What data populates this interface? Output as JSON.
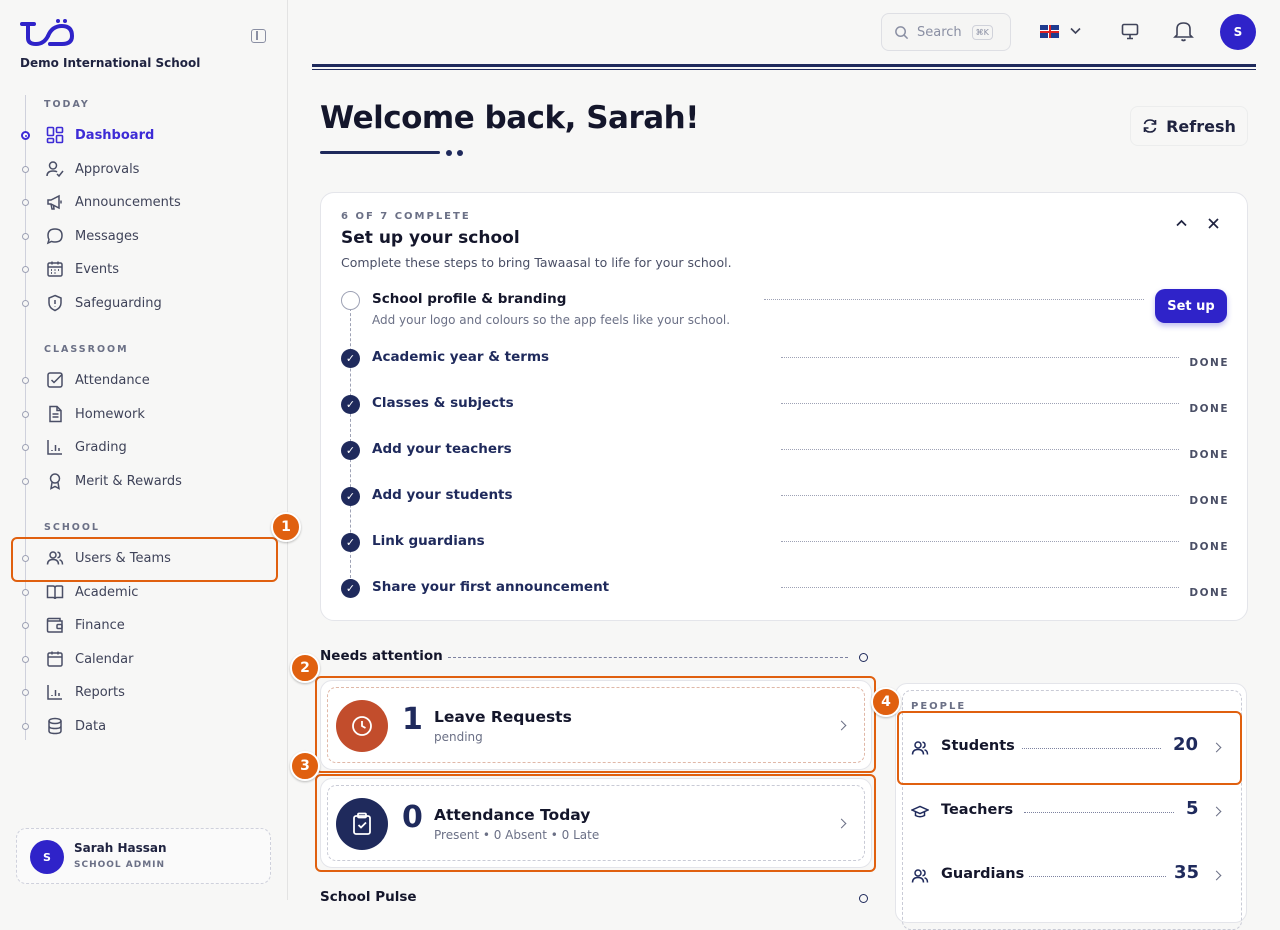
{
  "app": {
    "school_name": "Demo International School"
  },
  "sidebar": {
    "sections": [
      {
        "label": "TODAY"
      },
      {
        "label": "CLASSROOM"
      },
      {
        "label": "SCHOOL"
      }
    ],
    "items": [
      {
        "label": "Dashboard",
        "icon": "dashboard-icon",
        "active": true
      },
      {
        "label": "Approvals",
        "icon": "user-check-icon"
      },
      {
        "label": "Announcements",
        "icon": "megaphone-icon"
      },
      {
        "label": "Messages",
        "icon": "chat-bubble-icon"
      },
      {
        "label": "Events",
        "icon": "calendar-grid-icon"
      },
      {
        "label": "Safeguarding",
        "icon": "shield-icon"
      },
      {
        "label": "Attendance",
        "icon": "checkbox-icon"
      },
      {
        "label": "Homework",
        "icon": "document-icon"
      },
      {
        "label": "Grading",
        "icon": "bar-chart-icon"
      },
      {
        "label": "Merit & Rewards",
        "icon": "award-icon"
      },
      {
        "label": "Users & Teams",
        "icon": "users-icon"
      },
      {
        "label": "Academic",
        "icon": "book-icon"
      },
      {
        "label": "Finance",
        "icon": "wallet-icon"
      },
      {
        "label": "Calendar",
        "icon": "calendar-icon"
      },
      {
        "label": "Reports",
        "icon": "bar-chart-icon"
      },
      {
        "label": "Data",
        "icon": "database-icon"
      }
    ],
    "user": {
      "initial": "S",
      "name": "Sarah Hassan",
      "role": "SCHOOL ADMIN"
    }
  },
  "topbar": {
    "search_placeholder": "Search",
    "search_shortcut": "⌘K",
    "language_flag": "uk-flag",
    "avatar_initial": "S"
  },
  "main": {
    "welcome": "Welcome back, Sarah!",
    "refresh_label": "Refresh",
    "setup": {
      "progress": "6 OF 7 COMPLETE",
      "title": "Set up your school",
      "description": "Complete these steps to bring Tawaasal to life for your school.",
      "button": "Set up",
      "steps": [
        {
          "label": "School profile & branding",
          "sub": "Add your logo and colours so the app feels like your school.",
          "done": false
        },
        {
          "label": "Academic year & terms",
          "status": "DONE",
          "done": true
        },
        {
          "label": "Classes & subjects",
          "status": "DONE",
          "done": true
        },
        {
          "label": "Add your teachers",
          "status": "DONE",
          "done": true
        },
        {
          "label": "Add your students",
          "status": "DONE",
          "done": true
        },
        {
          "label": "Link guardians",
          "status": "DONE",
          "done": true
        },
        {
          "label": "Share your first announcement",
          "status": "DONE",
          "done": true
        }
      ]
    },
    "needs_attention": {
      "title": "Needs attention",
      "cards": [
        {
          "count": "1",
          "title": "Leave Requests",
          "sub": "pending",
          "icon": "clock-icon",
          "color": "#c24d2c"
        },
        {
          "count": "0",
          "title": "Attendance Today",
          "sub": "Present • 0 Absent • 0 Late",
          "icon": "clipboard-check-icon",
          "color": "#1f2a5c"
        }
      ]
    },
    "people": {
      "label": "PEOPLE",
      "rows": [
        {
          "name": "Students",
          "count": "20",
          "icon": "users-icon"
        },
        {
          "name": "Teachers",
          "count": "5",
          "icon": "graduation-cap-icon"
        },
        {
          "name": "Guardians",
          "count": "35",
          "icon": "users-icon"
        }
      ]
    },
    "school_pulse": "School Pulse"
  },
  "annotations": [
    "1",
    "2",
    "3",
    "4"
  ],
  "colors": {
    "accent": "#3d2bd6",
    "navy": "#1f2a5c",
    "highlight": "#e0600f"
  }
}
